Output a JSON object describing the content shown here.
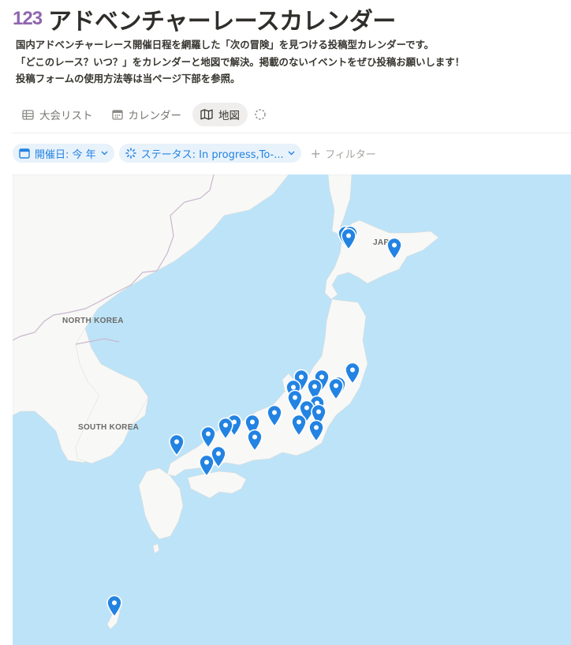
{
  "page": {
    "icon_text": "123",
    "title": "アドベンチャーレースカレンダー",
    "description": [
      "国内アドベンチャーレース開催日程を網羅した「次の冒険」を見つける投稿型カレンダーです。",
      "「どこのレース？いつ？」をカレンダーと地図で解決。掲載のないイベントをぜひ投稿お願いします！",
      "投稿フォームの使用方法等は当ページ下部を参照。"
    ]
  },
  "tabs": [
    {
      "label": "大会リスト",
      "icon": "table-icon",
      "active": false
    },
    {
      "label": "カレンダー",
      "icon": "calendar-icon",
      "active": false
    },
    {
      "label": "地図",
      "icon": "map-icon",
      "active": true
    }
  ],
  "filters": {
    "date_label": "開催日: 今 年",
    "status_label": "ステータス: In progress,To-...",
    "add_label": "フィルター"
  },
  "map": {
    "labels": {
      "north_korea": "NORTH KOREA",
      "south_korea": "SOUTH KOREA",
      "japan": "JAPAN"
    },
    "pin_color": "#2383e2",
    "pin_count": 27
  },
  "colors": {
    "accent": "#2383e2",
    "water": "#bde3f8",
    "land": "#f8f8f6",
    "title_icon": "#9065b0"
  }
}
